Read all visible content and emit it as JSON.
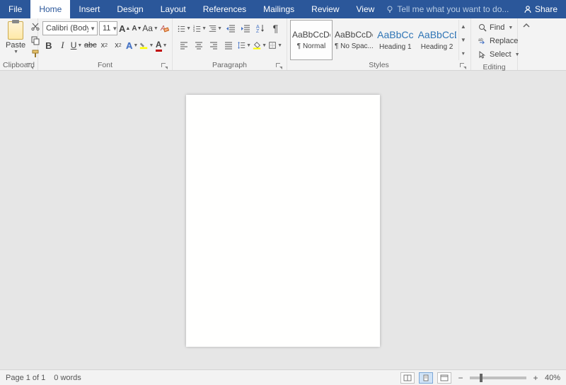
{
  "tabs": {
    "file": "File",
    "home": "Home",
    "insert": "Insert",
    "design": "Design",
    "layout": "Layout",
    "references": "References",
    "mailings": "Mailings",
    "review": "Review",
    "view": "View"
  },
  "tell_me_placeholder": "Tell me what you want to do...",
  "share_label": "Share",
  "clipboard": {
    "paste": "Paste",
    "label": "Clipboard"
  },
  "font": {
    "name": "Calibri (Body)",
    "size": "11",
    "label": "Font"
  },
  "paragraph": {
    "label": "Paragraph"
  },
  "styles": {
    "label": "Styles",
    "items": [
      {
        "preview": "AaBbCcDc",
        "name": "¶ Normal",
        "heading": false,
        "selected": true
      },
      {
        "preview": "AaBbCcDc",
        "name": "¶ No Spac...",
        "heading": false,
        "selected": false
      },
      {
        "preview": "AaBbCc",
        "name": "Heading 1",
        "heading": true,
        "selected": false
      },
      {
        "preview": "AaBbCcD",
        "name": "Heading 2",
        "heading": true,
        "selected": false
      }
    ]
  },
  "editing": {
    "label": "Editing",
    "find": "Find",
    "replace": "Replace",
    "select": "Select"
  },
  "status": {
    "page": "Page 1 of 1",
    "words": "0 words",
    "zoom": "40%"
  }
}
